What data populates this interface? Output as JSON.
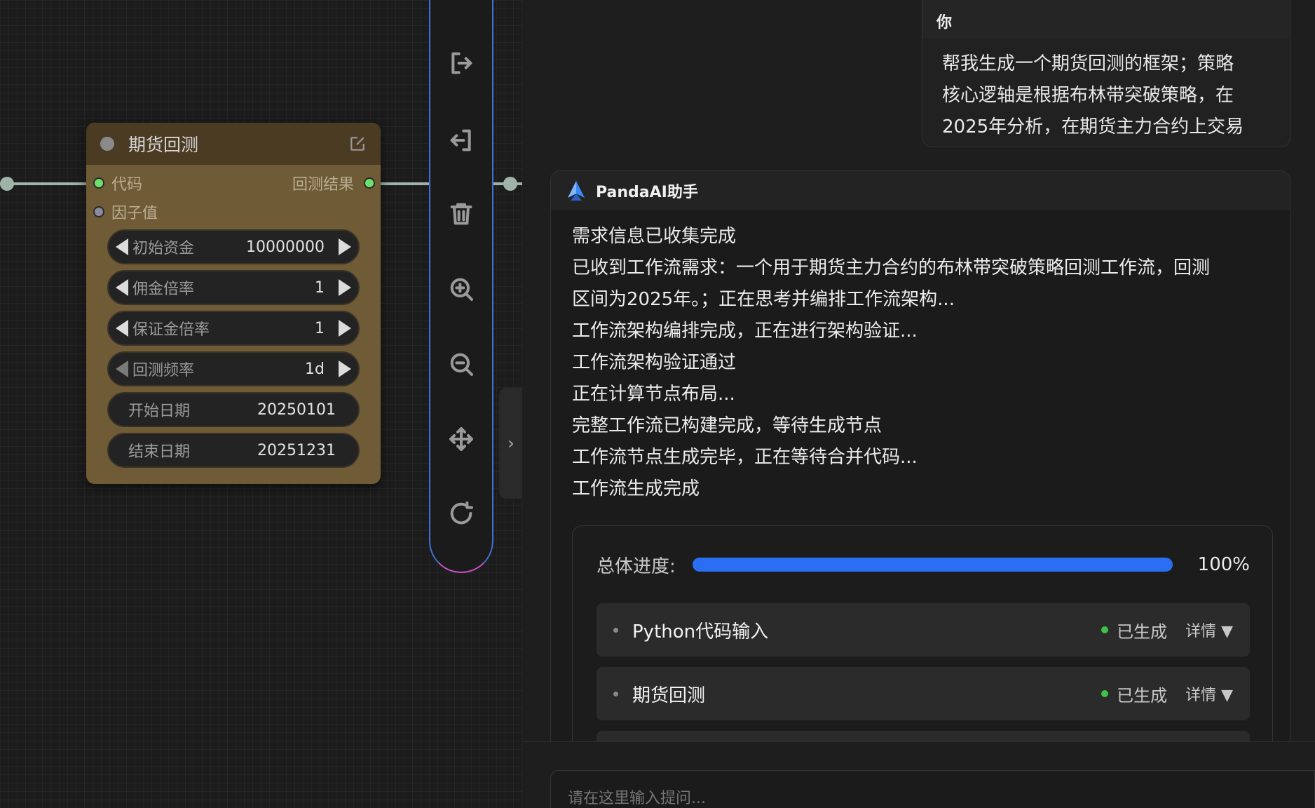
{
  "node": {
    "title": "期货回测",
    "inputs": [
      "代码",
      "因子值"
    ],
    "output": "回测结果",
    "widgets": [
      {
        "label": "初始资金",
        "value": "10000000",
        "stepper": true
      },
      {
        "label": "佣金倍率",
        "value": "1",
        "stepper": true
      },
      {
        "label": "保证金倍率",
        "value": "1",
        "stepper": true
      },
      {
        "label": "回测频率",
        "value": "1d",
        "stepper": true
      },
      {
        "label": "开始日期",
        "value": "20250101",
        "stepper": false
      },
      {
        "label": "结束日期",
        "value": "20251231",
        "stepper": false
      }
    ]
  },
  "toolbar": {
    "tools": [
      "export-icon",
      "import-icon",
      "trash-icon",
      "zoom-in-icon",
      "zoom-out-icon",
      "move-icon",
      "refresh-icon"
    ],
    "collapse_glyph": "›"
  },
  "chat": {
    "user": {
      "name": "你",
      "lines": [
        "帮我生成一个期货回测的框架；策略",
        "核心逻轴是根据布林带突破策略，在",
        "2025年分析，在期货主力合约上交易"
      ]
    },
    "assistant": {
      "name": "PandaAI助手",
      "lines": [
        "需求信息已收集完成",
        "已收到工作流需求：一个用于期货主力合约的布林带突破策略回测工作流，回测",
        "区间为2025年。；正在思考并编排工作流架构...",
        "工作流架构编排完成，正在进行架构验证...",
        "工作流架构验证通过",
        "正在计算节点布局...",
        "完整工作流已构建完成，等待生成节点",
        "工作流节点生成完毕，正在等待合并代码...",
        "工作流生成完成"
      ]
    },
    "progress": {
      "label": "总体进度:",
      "percent": 100,
      "percent_text": "100%",
      "accent": "#2a6ef3"
    },
    "tasks": [
      {
        "name": "Python代码输入",
        "status": "已生成",
        "detail": "详情 ▼"
      },
      {
        "name": "期货回测",
        "status": "已生成",
        "detail": "详情 ▼"
      }
    ],
    "input_placeholder": "请在这里输入提问..."
  }
}
